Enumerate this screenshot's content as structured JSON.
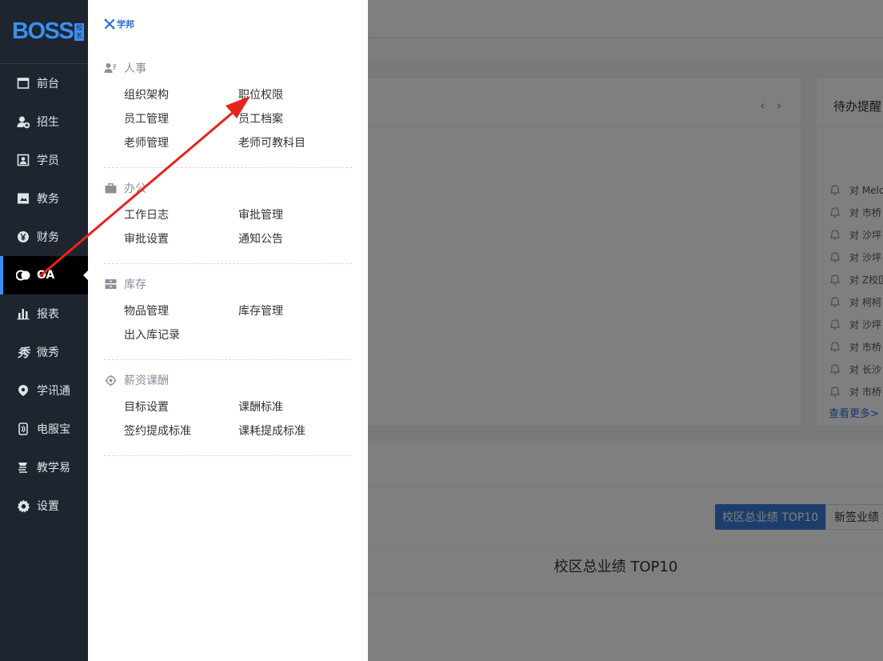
{
  "logo": {
    "text": "BOSS",
    "badge": "校长"
  },
  "sidebar": {
    "items": [
      {
        "label": "前台",
        "icon": "calendar-icon"
      },
      {
        "label": "招生",
        "icon": "add-user-icon"
      },
      {
        "label": "学员",
        "icon": "student-card-icon"
      },
      {
        "label": "教务",
        "icon": "book-icon"
      },
      {
        "label": "财务",
        "icon": "yen-icon"
      },
      {
        "label": "OA",
        "icon": "oa-icon",
        "active": true
      },
      {
        "label": "报表",
        "icon": "bar-chart-icon"
      },
      {
        "label": "微秀",
        "icon": "weixiu-icon"
      },
      {
        "label": "学讯通",
        "icon": "location-pin-icon"
      },
      {
        "label": "电服宝",
        "icon": "phone-icon"
      },
      {
        "label": "教学易",
        "icon": "teaching-icon"
      },
      {
        "label": "设置",
        "icon": "gear-icon"
      }
    ]
  },
  "flyout": {
    "brand": "学邦",
    "sections": [
      {
        "title": "人事",
        "icon": "person-icon",
        "links": [
          "组织架构",
          "职位权限",
          "员工管理",
          "员工档案",
          "老师管理",
          "老师可教科目"
        ]
      },
      {
        "title": "办公",
        "icon": "briefcase-icon",
        "links": [
          "工作日志",
          "审批管理",
          "审批设置",
          "通知公告"
        ]
      },
      {
        "title": "库存",
        "icon": "inventory-icon",
        "links": [
          "物品管理",
          "库存管理",
          "出入库记录"
        ]
      },
      {
        "title": "薪资课酬",
        "icon": "target-icon",
        "links": [
          "目标设置",
          "课酬标准",
          "签约提成标准",
          "课耗提成标准"
        ]
      }
    ]
  },
  "background": {
    "reminder_title": "待办提醒",
    "reminders": [
      "对 Melo",
      "对 市桥",
      "对 沙坪",
      "对 沙坪",
      "对 Z校区",
      "对 柯柯",
      "对 沙坪",
      "对 市桥",
      "对 长沙",
      "对 市桥"
    ],
    "more_link": "查看更多>",
    "tab_active": "校区总业绩 TOP10",
    "tab_other": "新签业绩 T",
    "chart_title": "校区总业绩 TOP10",
    "pager_prev": "‹",
    "pager_next": "›"
  },
  "colors": {
    "accent": "#3b8ff2",
    "sidebar_bg": "#1f252f",
    "annotation": "#e8231c"
  }
}
